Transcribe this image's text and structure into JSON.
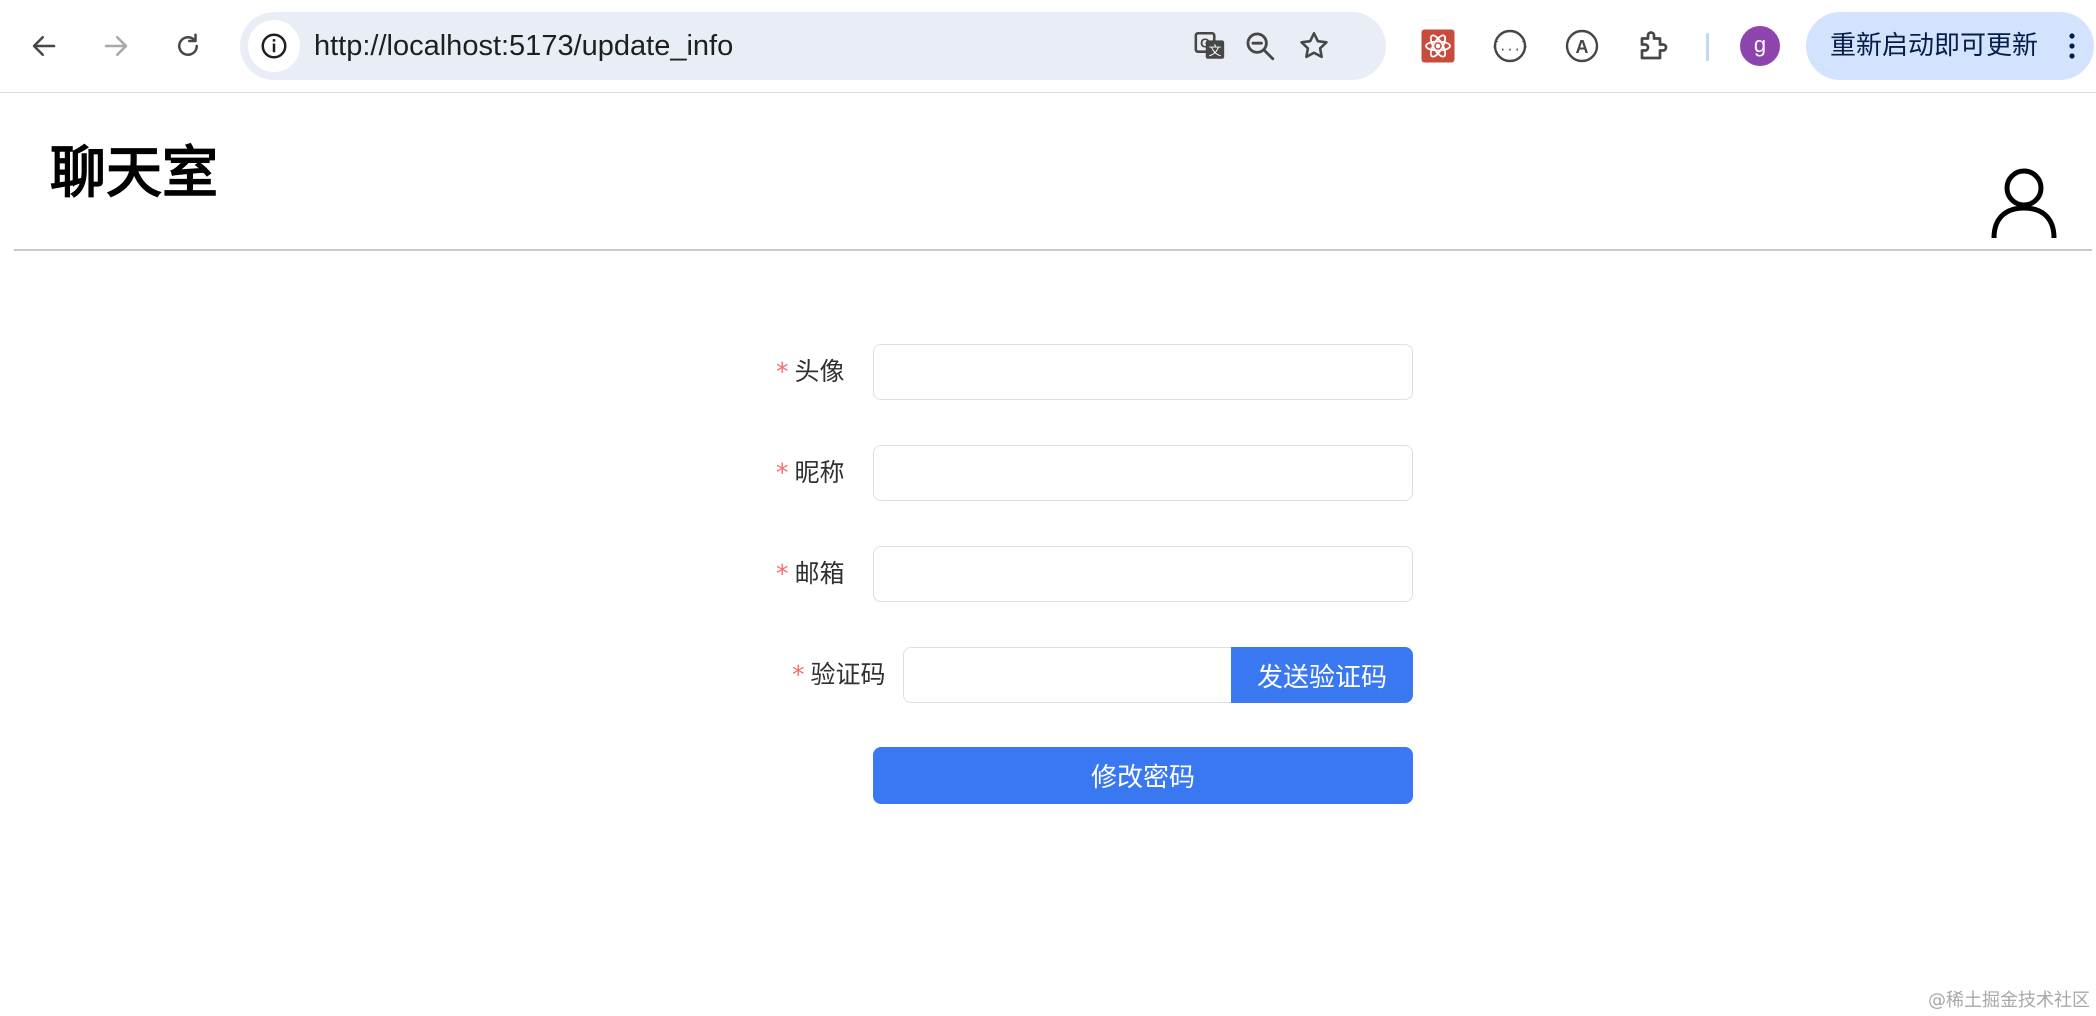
{
  "browser": {
    "url": "http://localhost:5173/update_info",
    "update_button_label": "重新启动即可更新",
    "profile_initial": "g"
  },
  "header": {
    "title": "聊天室"
  },
  "form": {
    "required_mark": "*",
    "avatar_label": "头像",
    "avatar_value": "",
    "nickname_label": "昵称",
    "nickname_value": "",
    "email_label": "邮箱",
    "email_value": "",
    "captcha_label": "验证码",
    "captcha_value": "",
    "send_code_label": "发送验证码",
    "submit_label": "修改密码"
  },
  "watermark": "@稀土掘金技术社区",
  "colors": {
    "primary": "#3a78f2",
    "required": "#f56c6c",
    "profile": "#8e44ad"
  }
}
